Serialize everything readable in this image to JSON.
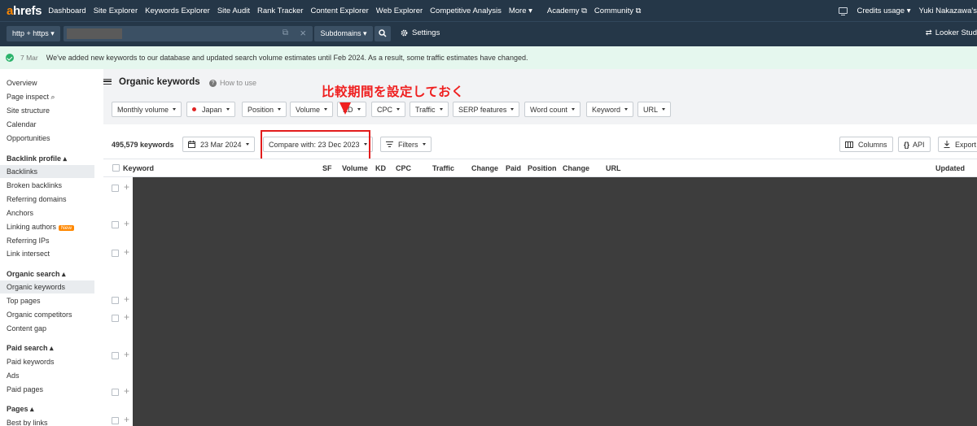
{
  "topnav": {
    "logo_a": "a",
    "logo_rest": "hrefs",
    "items": [
      "Dashboard",
      "Site Explorer",
      "Keywords Explorer",
      "Site Audit",
      "Rank Tracker",
      "Content Explorer",
      "Web Explorer",
      "Competitive Analysis",
      "More ▾",
      "Academy ⧉",
      "Community ⧉"
    ],
    "credits": "Credits usage ▾",
    "user": "Yuki Nakazawa's"
  },
  "searchbar": {
    "protocol": "http + https ▾",
    "subdomains": "Subdomains ▾",
    "settings": "Settings",
    "looker": "Looker Stud"
  },
  "banner": {
    "date": "7 Mar",
    "text": "We've added new keywords to our database and updated search volume estimates until Feb 2024. As a result, some traffic estimates have changed."
  },
  "sidebar": {
    "items": [
      "Overview",
      "Page inspect ⌕",
      "Site structure",
      "Calendar",
      "Opportunities"
    ],
    "backlink_head": "Backlink profile ▴",
    "backlink_items": [
      "Backlinks",
      "Broken backlinks",
      "Referring domains",
      "Anchors",
      "Linking authors",
      "Referring IPs",
      "Link intersect"
    ],
    "new_badge": "New",
    "organic_head": "Organic search ▴",
    "organic_items": [
      "Organic keywords",
      "Top pages",
      "Organic competitors",
      "Content gap"
    ],
    "paid_head": "Paid search ▴",
    "paid_items": [
      "Paid keywords",
      "Ads",
      "Paid pages"
    ],
    "pages_head": "Pages ▴",
    "pages_items": [
      "Best by links"
    ]
  },
  "main": {
    "title": "Organic keywords",
    "howto": "How to use",
    "annotation": "比較期間を設定しておく",
    "filters": [
      "Monthly volume",
      "Japan",
      "Position",
      "Volume",
      "KD",
      "CPC",
      "Traffic",
      "SERP features",
      "Word count",
      "Keyword",
      "URL"
    ],
    "keyword_count": "495,579 keywords",
    "date": "23 Mar 2024",
    "compare": "Compare with: 23 Dec 2023",
    "filters_btn": "Filters",
    "columns_btn": "Columns",
    "api_btn": "API",
    "export_btn": "Export"
  },
  "table": {
    "headers": [
      "Keyword",
      "SF",
      "Volume",
      "KD",
      "CPC",
      "Traffic",
      "Change",
      "Paid",
      "Position",
      "Change",
      "URL",
      "Updated"
    ]
  },
  "colors": {
    "nav_bg": "#253748",
    "accent": "#ff8800",
    "annotation": "#ef1f1f",
    "banner_bg": "#e5f7ee"
  }
}
